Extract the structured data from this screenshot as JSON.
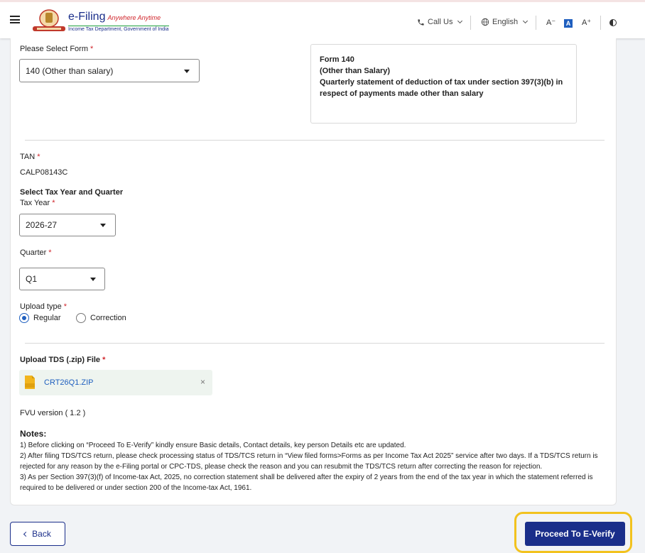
{
  "header": {
    "logo_title": "e-Filing",
    "logo_tagline": "Anywhere Anytime",
    "logo_subtitle": "Income Tax Department, Government of India",
    "call_us": "Call Us",
    "language": "English",
    "font_decrease": "A⁻",
    "font_normal": "A",
    "font_increase": "A⁺",
    "contrast_icon": "contrast-icon"
  },
  "form_select": {
    "label": "Please Select Form",
    "required": "*",
    "value": "140 (Other than salary)"
  },
  "form_info": {
    "line1": "Form 140",
    "line2": "(Other than Salary)",
    "line3": "Quarterly statement of deduction of tax under section 397(3)(b) in",
    "line4": "respect of payments made other than salary"
  },
  "tan": {
    "label": "TAN",
    "required": "*",
    "value": "CALP08143C"
  },
  "tax_period": {
    "heading": "Select Tax Year and Quarter",
    "year_label": "Tax Year",
    "year_value": "2026-27",
    "quarter_label": "Quarter",
    "quarter_value": "Q1",
    "required": "*"
  },
  "upload_type": {
    "label": "Upload type",
    "required": "*",
    "option_regular": "Regular",
    "option_correction": "Correction",
    "selected": "Regular"
  },
  "upload_file": {
    "label": "Upload TDS (.zip) File",
    "required": "*",
    "file_name": "CRT26Q1.ZIP",
    "file_badge": "ZIP",
    "remove_symbol": "×"
  },
  "fvu": {
    "text": "FVU version ( 1.2 )"
  },
  "notes": {
    "title": "Notes:",
    "items": [
      "1) Before clicking on “Proceed To E-Verify” kindly ensure Basic details, Contact details, key person Details etc are updated.",
      "2) After filing TDS/TCS return, please check processing status of TDS/TCS return in “View filed forms>Forms as per Income Tax Act 2025” service after two days. If a TDS/TCS return is rejected for any reason by the e-Filing portal or CPC-TDS, please check the reason and you can resubmit the TDS/TCS return after correcting the reason for rejection.",
      "3) As per Section 397(3)(f) of Income-tax Act, 2025, no correction statement shall be delivered after the expiry of 2 years from the end of the tax year in which the statement referred is required to be delivered or under section 200 of the Income-tax Act, 1961."
    ]
  },
  "actions": {
    "back": "Back",
    "proceed": "Proceed To E-Verify"
  },
  "colors": {
    "primary": "#1a2e8a",
    "link": "#1f5fbf",
    "required": "#d0262c",
    "highlight": "#f2c21e"
  }
}
